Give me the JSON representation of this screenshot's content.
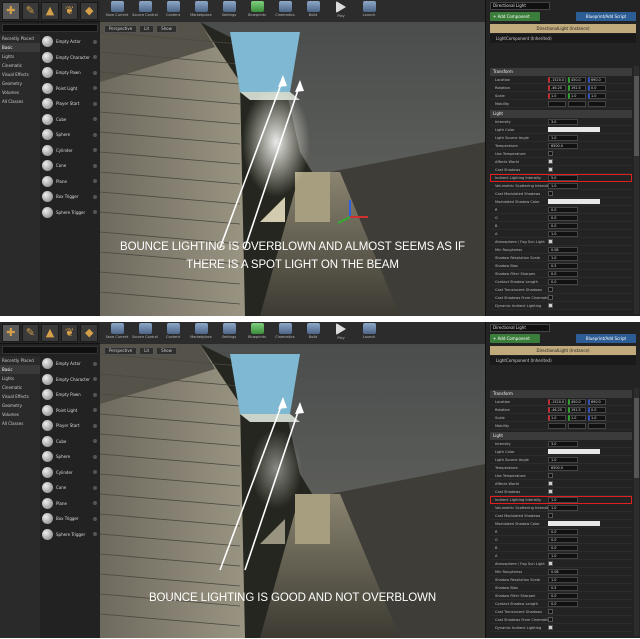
{
  "modes": [
    "place-mode",
    "paint-mode",
    "landscape-mode",
    "foliage-mode",
    "geometry-mode"
  ],
  "search_placeholder": "Search Classes",
  "categories": [
    "Recently Placed",
    "Basic",
    "Lights",
    "Cinematic",
    "Visual Effects",
    "Geometry",
    "Volumes",
    "All Classes"
  ],
  "place_items": [
    "Empty Actor",
    "Empty Character",
    "Empty Pawn",
    "Point Light",
    "Player Start",
    "Cube",
    "Sphere",
    "Cylinder",
    "Cone",
    "Plane",
    "Box Trigger",
    "Sphere Trigger"
  ],
  "toolbar": [
    "Save Current",
    "Source Control",
    "Content",
    "Marketplace",
    "Settings",
    "Blueprints",
    "Cinematics",
    "Build",
    "Play",
    "Launch"
  ],
  "viewport_tools": [
    "Perspective",
    "Lit",
    "Show"
  ],
  "details": {
    "name": "Directional Light",
    "add_component": "+ Add Component",
    "blueprint": "Blueprint/Add Script",
    "component_header": "DirectionalLight (Instance)",
    "component_item": "LightComponent (Inherited)",
    "sections": {
      "transform": "Transform",
      "light": "Light"
    },
    "transform_rows": [
      {
        "label": "Location",
        "x": "-1520.0",
        "y": "450.0",
        "z": "690.0"
      },
      {
        "label": "Rotation",
        "x": "-46.25",
        "y": "192.5",
        "z": "0.0"
      },
      {
        "label": "Scale",
        "x": "1.0",
        "y": "1.0",
        "z": "1.0"
      }
    ],
    "mobility_label": "Mobility",
    "light_rows": [
      {
        "label": "Intensity",
        "type": "num",
        "value": "3.0"
      },
      {
        "label": "Light Color",
        "type": "color"
      },
      {
        "label": "Light Source Angle",
        "type": "num",
        "value": "1.0"
      },
      {
        "label": "Temperature",
        "type": "num",
        "value": "6500.0"
      },
      {
        "label": "Use Temperature",
        "type": "check",
        "on": false
      },
      {
        "label": "Affects World",
        "type": "check",
        "on": true
      },
      {
        "label": "Cast Shadows",
        "type": "check",
        "on": true
      },
      {
        "label": "Indirect Lighting Intensity",
        "type": "num",
        "value": "",
        "highlight": true
      },
      {
        "label": "Volumetric Scattering Intensity",
        "type": "num",
        "value": "1.0"
      },
      {
        "label": "Cast Modulated Shadows",
        "type": "check",
        "on": false
      },
      {
        "label": "Modulated Shadow Color",
        "type": "color"
      },
      {
        "label": "R",
        "type": "num",
        "value": "0.0"
      },
      {
        "label": "G",
        "type": "num",
        "value": "0.0"
      },
      {
        "label": "B",
        "type": "num",
        "value": "0.0"
      },
      {
        "label": "A",
        "type": "num",
        "value": "1.0"
      },
      {
        "label": "Atmosphere / Fog Sun Light",
        "type": "check",
        "on": true
      },
      {
        "label": "Min Roughness",
        "type": "num",
        "value": "0.08"
      },
      {
        "label": "Shadow Resolution Scale",
        "type": "num",
        "value": "1.0"
      },
      {
        "label": "Shadow Bias",
        "type": "num",
        "value": "0.5"
      },
      {
        "label": "Shadow Filter Sharpen",
        "type": "num",
        "value": "0.0"
      },
      {
        "label": "Contact Shadow Length",
        "type": "num",
        "value": "0.0"
      },
      {
        "label": "Cast Translucent Shadows",
        "type": "check",
        "on": false
      },
      {
        "label": "Cast Shadows From Cinematic Objects",
        "type": "check",
        "on": false
      },
      {
        "label": "Dynamic Indirect Lighting",
        "type": "check",
        "on": true
      }
    ]
  },
  "panels": {
    "top": {
      "caption": "BOUNCE LIGHTING IS OVERBLOWN AND ALMOST SEEMS AS IF THERE IS A SPOT LIGHT ON THE BEAM",
      "indirect_value": "5.0"
    },
    "bottom": {
      "caption": "BOUNCE LIGHTING IS GOOD AND NOT OVERBLOWN",
      "indirect_value": "1.0"
    }
  },
  "colors": {
    "accent_green": "#3b7e3b",
    "accent_blue": "#2d5d95",
    "highlight": "#e02020"
  }
}
